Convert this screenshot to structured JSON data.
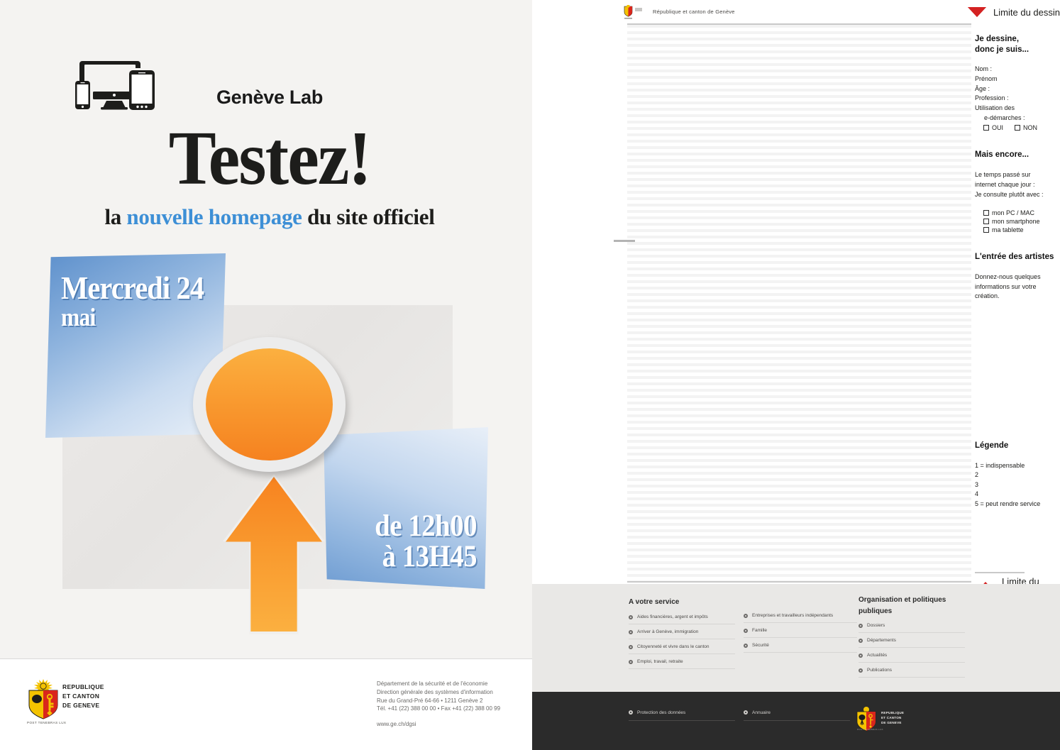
{
  "poster": {
    "icon": "devices-icon",
    "lab_title": "Genève Lab",
    "headline": "Testez!",
    "subtitle_pre": "la ",
    "subtitle_highlight": "nouvelle homepage",
    "subtitle_post": " du site officiel",
    "highlight_color": "#3d8fd6",
    "date_line1": "Mercredi 24",
    "date_line2": "mai",
    "time_line1": "de 12h00",
    "time_line2": "à 13H45",
    "footer": {
      "crest_words": [
        "REPUBLIQUE",
        "ET CANTON",
        "DE GENEVE"
      ],
      "crest_caption": "POST TENEBRAS LUX",
      "dept_lines": [
        "Département de la sécurité et de l'économie",
        "Direction générale des systèmes d'information",
        "Rue du Grand-Pré 64-66 • 1211 Genève 2",
        "Tél. +41 (22) 388 00 00 • Fax +41 (22) 388 00 99"
      ],
      "url": "www.ge.ch/dgsi"
    }
  },
  "page": {
    "header": {
      "logo_text": "République et canton de Genève",
      "limite_label": "Limite du dessin"
    },
    "limite_bottom_label": "Limite du dessin",
    "sidebar": {
      "identity_title_l1": "Je dessine,",
      "identity_title_l2": "donc je suis...",
      "fields": [
        "Nom :",
        "Prénom",
        "Âge :",
        "Profession :",
        "Utilisation des"
      ],
      "field_indent": "e-démarches :",
      "yes_label": "OUI",
      "no_label": "NON",
      "more_title": "Mais encore...",
      "more_lines": [
        "Le temps passé sur",
        "internet chaque jour :",
        "Je consulte plutôt avec :"
      ],
      "device_options": [
        "mon PC / MAC",
        "mon smartphone",
        "ma tablette"
      ],
      "artists_title": "L'entrée des artistes",
      "artists_lines": [
        "Donnez-nous quelques",
        "informations sur votre",
        "création."
      ],
      "legend_title": "Légende",
      "legend_lines": [
        "1 = indispensable",
        "2",
        "3",
        "4",
        "5 = peut rendre service"
      ]
    },
    "footer_nav": {
      "col1_title": "A votre service",
      "col1_items": [
        "Aides financières, argent et impôts",
        "Arriver à Genève, immigration",
        "Citoyenneté et vivre dans le canton",
        "Emploi, travail, retraite"
      ],
      "col2_items": [
        "Entreprises et travailleurs indépendants",
        "Famille",
        "Sécurité"
      ],
      "col3_title_l1": "Organisation et politiques",
      "col3_title_l2": "publiques",
      "col3_items": [
        "Dossiers",
        "Départements",
        "Actualités",
        "Publications"
      ]
    },
    "dark_footer": {
      "item1": "Protection des données",
      "item2": "Annuaire",
      "crest_words": [
        "REPUBLIQUE",
        "ET CANTON",
        "DE GENEVE"
      ],
      "crest_caption": "POST TENEBRAS LUX"
    }
  }
}
